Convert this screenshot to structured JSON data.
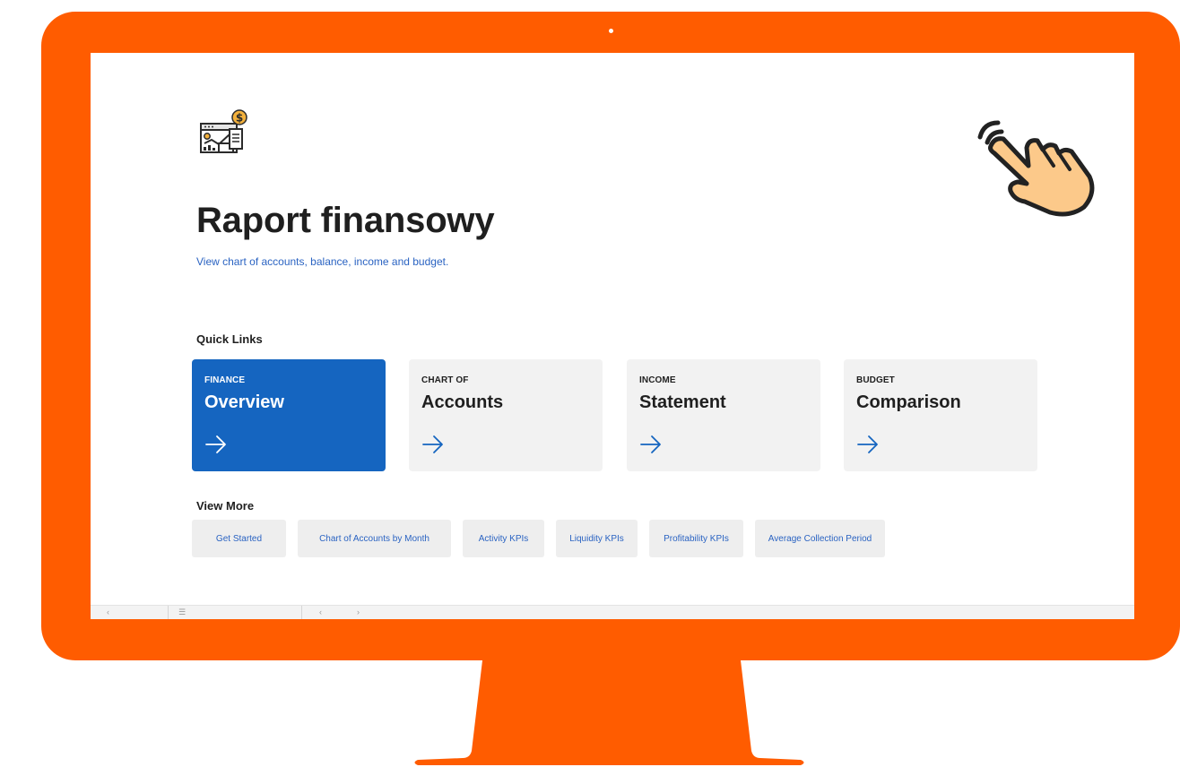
{
  "page": {
    "title": "Raport finansowy",
    "subtitle": "View chart of accounts, balance, income and budget."
  },
  "quick_links": {
    "label": "Quick Links",
    "cards": [
      {
        "eyebrow": "FINANCE",
        "title": "Overview",
        "active": true
      },
      {
        "eyebrow": "CHART OF",
        "title": "Accounts",
        "active": false
      },
      {
        "eyebrow": "INCOME",
        "title": "Statement",
        "active": false
      },
      {
        "eyebrow": "BUDGET",
        "title": "Comparison",
        "active": false
      }
    ]
  },
  "view_more": {
    "label": "View More",
    "links": [
      {
        "label": "Get Started"
      },
      {
        "label": "Chart of Accounts by Month"
      },
      {
        "label": "Activity KPIs"
      },
      {
        "label": "Liquidity KPIs"
      },
      {
        "label": "Profitability KPIs"
      },
      {
        "label": "Average Collection Period"
      }
    ]
  },
  "icons": {
    "report": "financial-report-icon",
    "hand": "pointing-hand-icon",
    "arrow": "arrow-right-icon"
  },
  "colors": {
    "frame": "#ff5c00",
    "primary": "#1565c0",
    "link": "#2a63c2",
    "card_bg": "#f2f2f2",
    "pill_bg": "#eeeeee"
  }
}
